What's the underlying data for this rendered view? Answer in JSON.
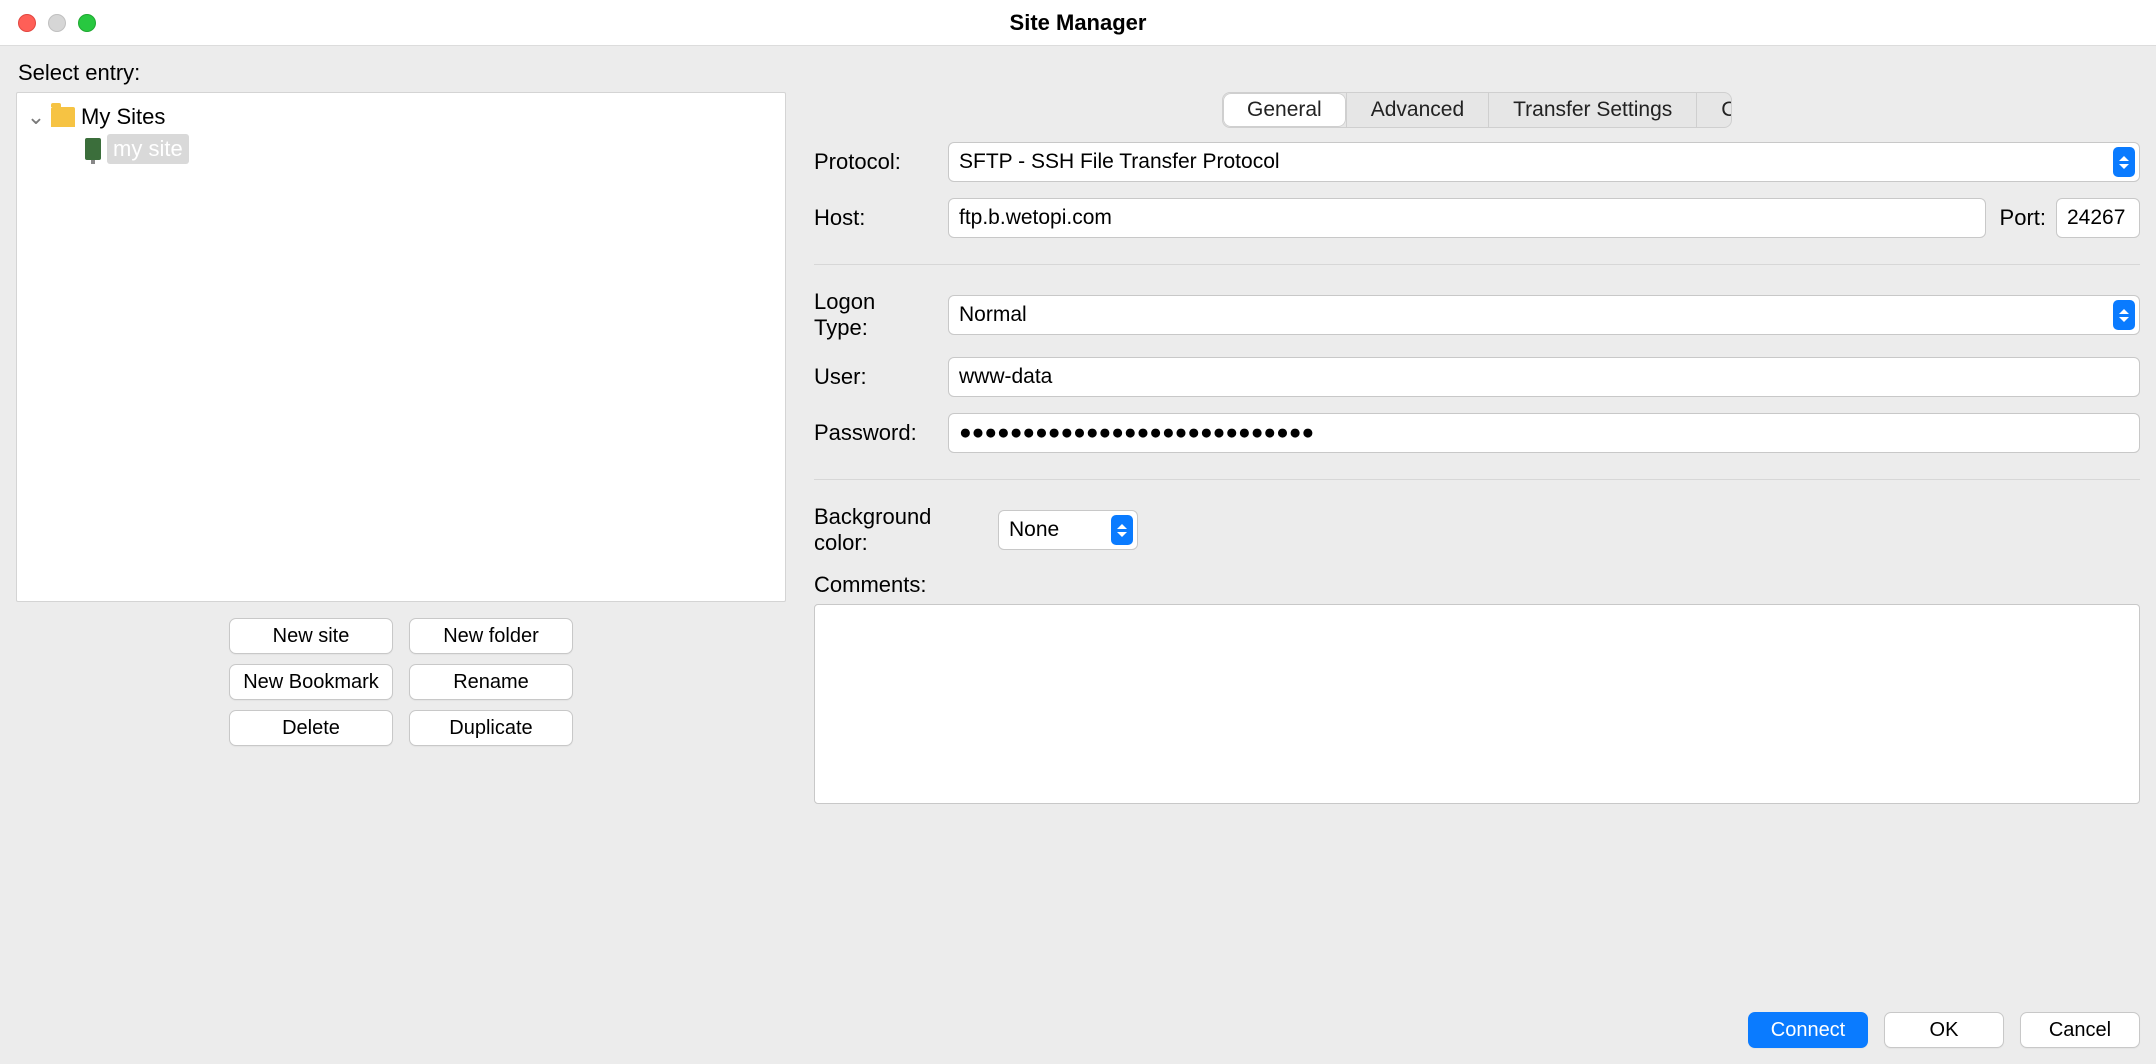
{
  "window": {
    "title": "Site Manager"
  },
  "left": {
    "select_label": "Select entry:",
    "root_label": "My Sites",
    "site_label": "my site",
    "buttons": {
      "new_site": "New site",
      "new_folder": "New folder",
      "new_bookmark": "New Bookmark",
      "rename": "Rename",
      "delete": "Delete",
      "duplicate": "Duplicate"
    }
  },
  "tabs": {
    "general": "General",
    "advanced": "Advanced",
    "transfer": "Transfer Settings",
    "charset": "Charset"
  },
  "form": {
    "protocol_label": "Protocol:",
    "protocol_value": "SFTP - SSH File Transfer Protocol",
    "host_label": "Host:",
    "host_value": "ftp.b.wetopi.com",
    "port_label": "Port:",
    "port_value": "24267",
    "logon_label": "Logon Type:",
    "logon_value": "Normal",
    "user_label": "User:",
    "user_value": "www-data",
    "password_label": "Password:",
    "password_value": "●●●●●●●●●●●●●●●●●●●●●●●●●●●●",
    "bgcolor_label": "Background color:",
    "bgcolor_value": "None",
    "comments_label": "Comments:",
    "comments_value": ""
  },
  "footer": {
    "connect": "Connect",
    "ok": "OK",
    "cancel": "Cancel"
  }
}
